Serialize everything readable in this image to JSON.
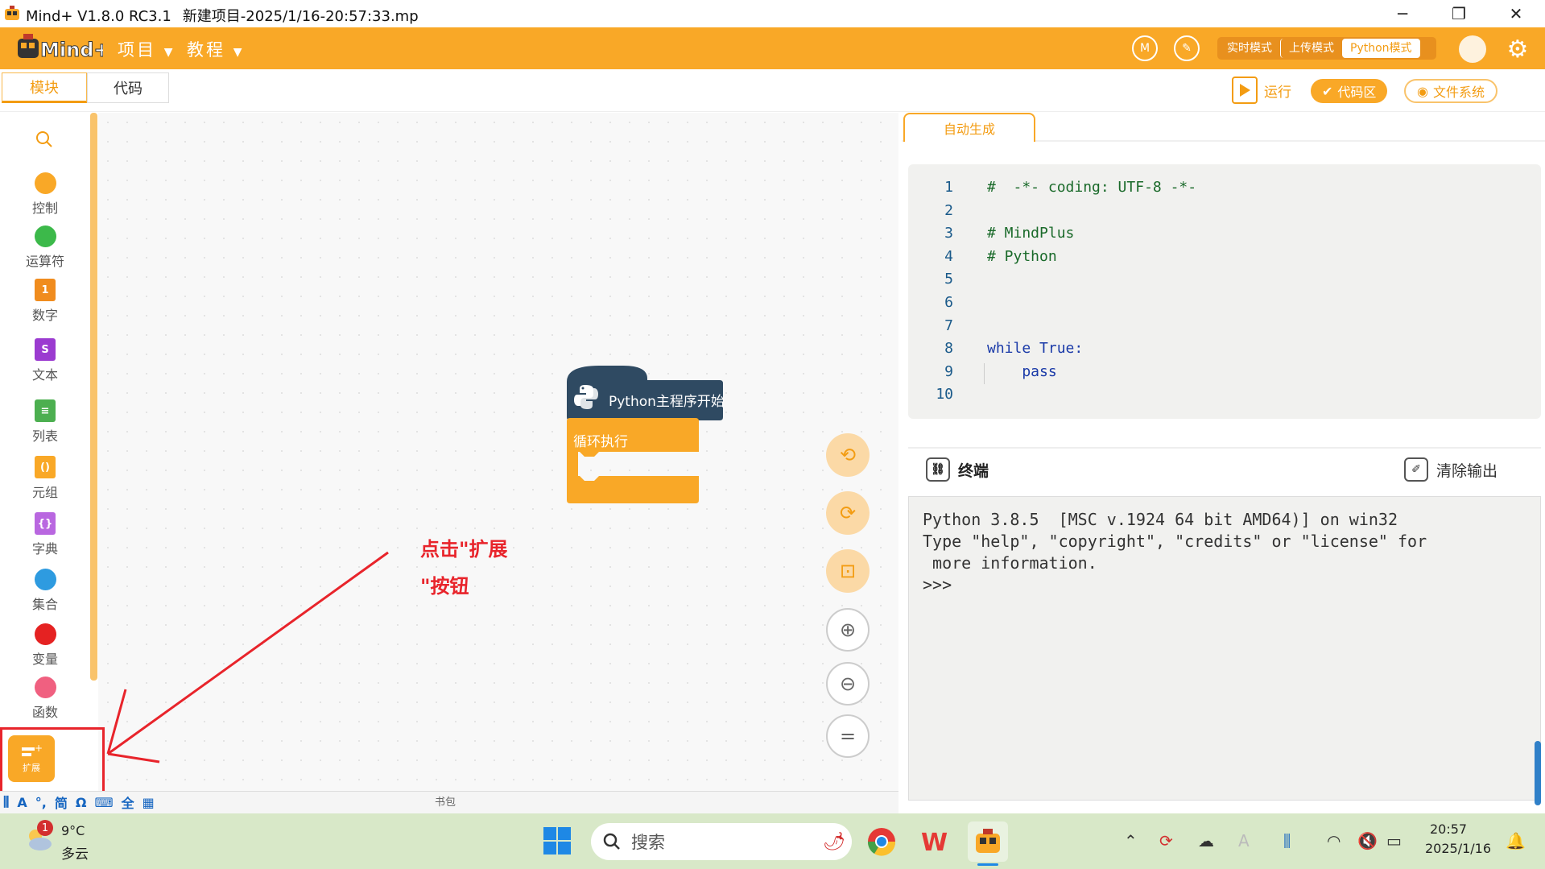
{
  "window": {
    "app_version": "Mind+ V1.8.0 RC3.1",
    "project_title": "新建项目-2025/1/16-20:57:33.mp",
    "minimize": "─",
    "maximize": "❐",
    "close": "✕"
  },
  "menu": {
    "logo": "Mind+",
    "project": "项目",
    "tutorial": "教程",
    "modes": [
      "实时模式",
      "上传模式",
      "Python模式"
    ],
    "active_mode": "Python模式"
  },
  "tabs": {
    "blocks": "模块",
    "code": "代码"
  },
  "toolbar": {
    "run": "运行",
    "code_area": "代码区",
    "file_system": "文件系统"
  },
  "categories": [
    {
      "label": "控制",
      "color": "#f9a827",
      "shape": "dot"
    },
    {
      "label": "运算符",
      "color": "#3cb94a",
      "shape": "dot"
    },
    {
      "label": "数字",
      "color": "#f08c1e",
      "shape": "sq",
      "glyph": "1"
    },
    {
      "label": "文本",
      "color": "#9b3bd0",
      "shape": "sq",
      "glyph": "S"
    },
    {
      "label": "列表",
      "color": "#4caf50",
      "shape": "sq",
      "glyph": "≡"
    },
    {
      "label": "元组",
      "color": "#f9a827",
      "shape": "sq",
      "glyph": "()"
    },
    {
      "label": "字典",
      "color": "#b967e0",
      "shape": "sq",
      "glyph": "{}"
    },
    {
      "label": "集合",
      "color": "#2e9be0",
      "shape": "dot"
    },
    {
      "label": "变量",
      "color": "#e52222",
      "shape": "dot"
    },
    {
      "label": "函数",
      "color": "#f06080",
      "shape": "dot"
    }
  ],
  "extension": {
    "label": "扩展"
  },
  "blocks": {
    "start": "Python主程序开始",
    "loop": "循环执行"
  },
  "bottom": {
    "backpack": "书包",
    "ime": [
      "A",
      "简",
      "Ω",
      "全"
    ]
  },
  "code_panel": {
    "tab": "自动生成",
    "lines": [
      {
        "n": "1",
        "text": "#  -*- coding: UTF-8 -*-",
        "kind": "cm"
      },
      {
        "n": "2",
        "text": "",
        "kind": "plain"
      },
      {
        "n": "3",
        "text": "# MindPlus",
        "kind": "cm"
      },
      {
        "n": "4",
        "text": "# Python",
        "kind": "cm"
      },
      {
        "n": "5",
        "text": "",
        "kind": "plain"
      },
      {
        "n": "6",
        "text": "",
        "kind": "plain"
      },
      {
        "n": "7",
        "text": "",
        "kind": "plain"
      },
      {
        "n": "8",
        "text": "while True:",
        "kind": "kw"
      },
      {
        "n": "9",
        "text": "    pass",
        "kind": "kw"
      },
      {
        "n": "10",
        "text": "",
        "kind": "plain"
      }
    ]
  },
  "terminal": {
    "title": "终端",
    "clear": "清除输出",
    "output": "Python 3.8.5  [MSC v.1924 64 bit AMD64)] on win32\nType \"help\", \"copyright\", \"credits\" or \"license\" for\n more information.\n>>>"
  },
  "annotation": {
    "line1": "点击\"扩展",
    "line2": "\"按钮"
  },
  "taskbar": {
    "weather_temp": "9°C",
    "weather_desc": "多云",
    "weather_badge": "1",
    "search": "搜索",
    "time": "20:57",
    "date": "2025/1/16"
  }
}
